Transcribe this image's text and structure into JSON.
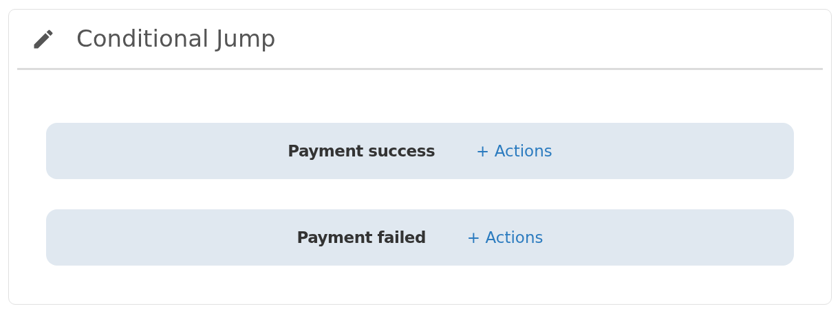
{
  "panel": {
    "title": "Conditional Jump"
  },
  "conditions": [
    {
      "label": "Payment success",
      "action": "+ Actions"
    },
    {
      "label": "Payment failed",
      "action": "+ Actions"
    }
  ]
}
